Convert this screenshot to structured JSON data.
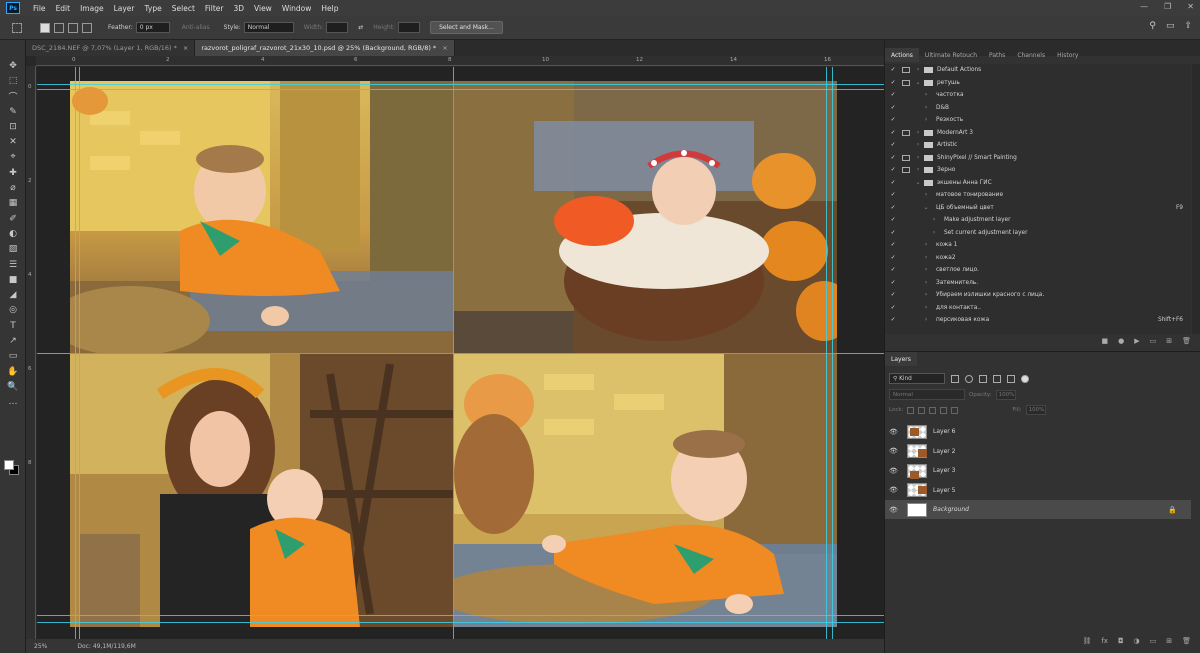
{
  "app": {
    "logo": "Ps"
  },
  "menu": [
    "File",
    "Edit",
    "Image",
    "Layer",
    "Type",
    "Select",
    "Filter",
    "3D",
    "View",
    "Window",
    "Help"
  ],
  "window_controls": [
    "—",
    "❐",
    "✕"
  ],
  "options": {
    "feather_label": "Feather:",
    "feather_value": "0 px",
    "anti_alias_label": "Anti-alias",
    "style_label": "Style:",
    "style_value": "Normal",
    "width_label": "Width:",
    "height_label": "Height:",
    "select_mask_label": "Select and Mask..."
  },
  "tabs": [
    {
      "label": "DSC_2184.NEF @ 7,07% (Layer 1, RGB/16) *",
      "close": "×"
    },
    {
      "label": "razvorot_poligraf_razvorot_21x30_10.psd @ 25% (Background, RGB/8) *",
      "close": "×"
    }
  ],
  "tools": [
    "✥",
    "⬚",
    "⌒",
    "✎",
    "⊡",
    "✕",
    "⌖",
    "✚",
    "⌀",
    "▦",
    "✐",
    "◐",
    "▨",
    "☰",
    "■",
    "◢",
    "◎",
    "T",
    "↗",
    "▭",
    "✋",
    "🔍",
    "…"
  ],
  "ruler_h": [
    "0",
    "2",
    "4",
    "6",
    "8",
    "10",
    "12",
    "14",
    "16"
  ],
  "ruler_v": [
    "0",
    "2",
    "4",
    "6",
    "8"
  ],
  "status": {
    "zoom": "25%",
    "doc": "Doc: 49,1M/119,6M"
  },
  "panel_tabs": [
    "Actions",
    "Ultimate Retouch",
    "Paths",
    "Channels",
    "History"
  ],
  "actions": [
    {
      "check": "✓",
      "dlg": true,
      "chev": "›",
      "folder": true,
      "label": "Default Actions",
      "indent": 0
    },
    {
      "check": "✓",
      "dlg": true,
      "chev": "⌄",
      "folder": true,
      "label": "ретушь",
      "indent": 0
    },
    {
      "check": "✓",
      "dlg": false,
      "chev": "›",
      "folder": false,
      "label": "частотка",
      "indent": 1
    },
    {
      "check": "✓",
      "dlg": false,
      "chev": "›",
      "folder": false,
      "label": "D&B",
      "indent": 1
    },
    {
      "check": "✓",
      "dlg": false,
      "chev": "›",
      "folder": false,
      "label": "Резкость",
      "indent": 1
    },
    {
      "check": "✓",
      "dlg": true,
      "chev": "›",
      "folder": true,
      "label": "ModernArt 3",
      "indent": 0
    },
    {
      "check": "✓",
      "dlg": false,
      "chev": "›",
      "folder": true,
      "label": "Artistic",
      "indent": 0
    },
    {
      "check": "✓",
      "dlg": true,
      "chev": "›",
      "folder": true,
      "label": "ShinyPixel // Smart Painting",
      "indent": 0
    },
    {
      "check": "✓",
      "dlg": true,
      "chev": "›",
      "folder": true,
      "label": "Зерно",
      "indent": 0
    },
    {
      "check": "✓",
      "dlg": false,
      "chev": "⌄",
      "folder": true,
      "label": "экшены Анна ГИС",
      "indent": 0
    },
    {
      "check": "✓",
      "dlg": false,
      "chev": "›",
      "folder": false,
      "label": "матовое тонирование",
      "indent": 1
    },
    {
      "check": "✓",
      "dlg": false,
      "chev": "⌄",
      "folder": false,
      "label": "ЦБ объемный цвет",
      "indent": 1,
      "shortcut": "F9"
    },
    {
      "check": "✓",
      "dlg": false,
      "chev": "›",
      "folder": false,
      "label": "Make adjustment layer",
      "indent": 2
    },
    {
      "check": "✓",
      "dlg": false,
      "chev": "›",
      "folder": false,
      "label": "Set current adjustment layer",
      "indent": 2
    },
    {
      "check": "✓",
      "dlg": false,
      "chev": "›",
      "folder": false,
      "label": "кожа 1",
      "indent": 1
    },
    {
      "check": "✓",
      "dlg": false,
      "chev": "›",
      "folder": false,
      "label": "кожа2",
      "indent": 1
    },
    {
      "check": "✓",
      "dlg": false,
      "chev": "›",
      "folder": false,
      "label": "светлое лицо.",
      "indent": 1
    },
    {
      "check": "✓",
      "dlg": false,
      "chev": "›",
      "folder": false,
      "label": "Затемнитель.",
      "indent": 1
    },
    {
      "check": "✓",
      "dlg": false,
      "chev": "›",
      "folder": false,
      "label": "Убираем излишки красного с лица.",
      "indent": 1
    },
    {
      "check": "✓",
      "dlg": false,
      "chev": "›",
      "folder": false,
      "label": "для контакта..",
      "indent": 1
    },
    {
      "check": "✓",
      "dlg": false,
      "chev": "›",
      "folder": false,
      "label": "персиковая кожа",
      "indent": 1,
      "shortcut": "Shift+F6"
    }
  ],
  "actions_footer": [
    "■",
    "●",
    "▶",
    "▭",
    "⊞",
    "🗑"
  ],
  "layers_panel": {
    "title": "Layers",
    "kind_label": "⚲ Kind",
    "blend_mode": "Normal",
    "opacity_label": "Opacity:",
    "opacity_value": "100%",
    "lock_label": "Lock:",
    "fill_label": "Fill:",
    "fill_value": "100%",
    "layers": [
      {
        "name": "Layer 6",
        "selected": false,
        "thumb": "transparent",
        "locked": false
      },
      {
        "name": "Layer 2",
        "selected": false,
        "thumb": "transparent",
        "locked": false
      },
      {
        "name": "Layer 3",
        "selected": false,
        "thumb": "transparent",
        "locked": false
      },
      {
        "name": "Layer 5",
        "selected": false,
        "thumb": "transparent",
        "locked": false
      },
      {
        "name": "Background",
        "selected": true,
        "thumb": "white",
        "locked": true
      }
    ],
    "footer": [
      "⛓",
      "fx",
      "◘",
      "◑",
      "▭",
      "⊞",
      "🗑"
    ]
  },
  "colors": {
    "guide": "#3ad0e8",
    "accent": "#31a8ff"
  }
}
